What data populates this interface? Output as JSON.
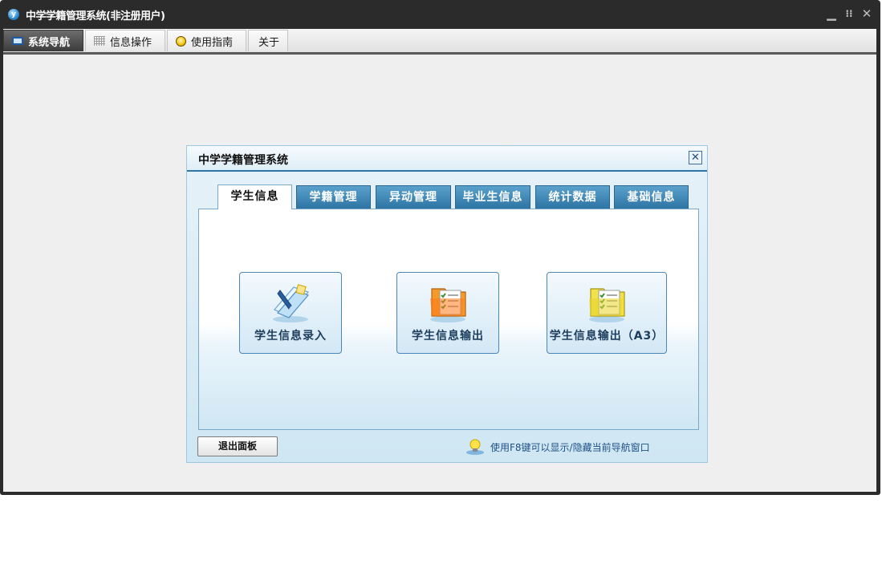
{
  "app": {
    "title": "中学学籍管理系统(非注册用户)",
    "logo_text": "y"
  },
  "window_controls": {
    "minimize": "▁",
    "restore": "⁝⁝",
    "close": "✕"
  },
  "ribbon_tabs": [
    {
      "label": "系统导航",
      "icon": "monitor-icon",
      "active": true
    },
    {
      "label": "信息操作",
      "icon": "grid-icon",
      "active": false
    },
    {
      "label": "使用指南",
      "icon": "help-icon",
      "active": false
    },
    {
      "label": "关于",
      "icon": "",
      "active": false
    }
  ],
  "panel": {
    "title": "中学学籍管理系统",
    "close_glyph": "✕",
    "tabs": [
      {
        "label": "学生信息",
        "active": true
      },
      {
        "label": "学籍管理",
        "active": false
      },
      {
        "label": "异动管理",
        "active": false
      },
      {
        "label": "毕业生信息",
        "active": false
      },
      {
        "label": "统计数据",
        "active": false
      },
      {
        "label": "基础信息",
        "active": false
      }
    ],
    "actions": [
      {
        "label": "学生信息录入",
        "icon": "student-entry-icon"
      },
      {
        "label": "学生信息输出",
        "icon": "folder-list-icon"
      },
      {
        "label": "学生信息输出（A3）",
        "icon": "folder-list-a3-icon"
      }
    ],
    "exit_label": "退出面板",
    "hint": "使用F8键可以显示/隐藏当前导航窗口"
  },
  "colors": {
    "titlebar": "#2b2b2b",
    "navtab": "#2e74a4",
    "accent": "#1f4f86"
  }
}
